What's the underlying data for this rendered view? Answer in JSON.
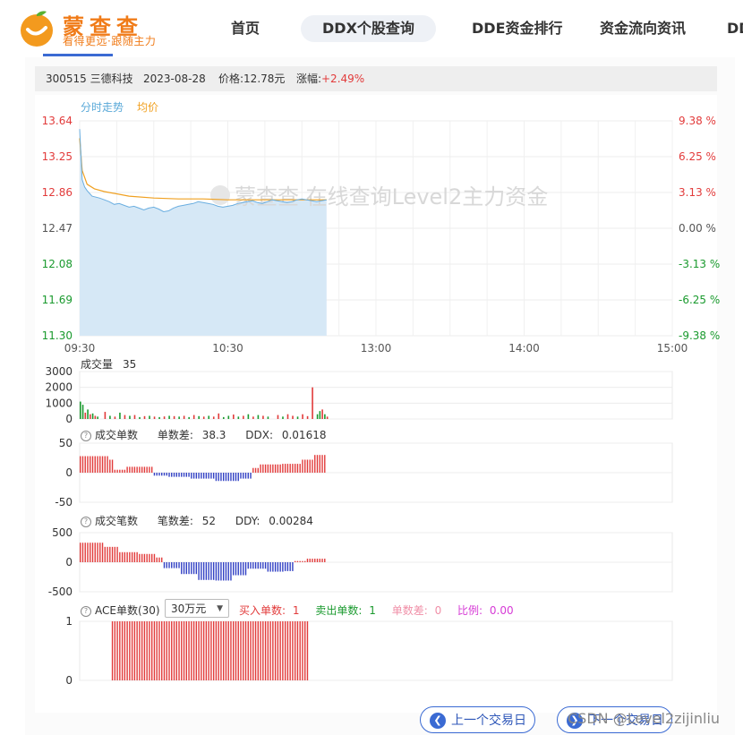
{
  "header": {
    "logo_title": "蒙查查",
    "logo_slogan": "看得更远·跟随主力",
    "nav": [
      "首页",
      "DDX个股查询",
      "DDE资金排行",
      "资金流向资讯",
      "DD"
    ],
    "active_nav": "DDX个股查询"
  },
  "info": {
    "code_name": "300515 三德科技",
    "date": "2023-08-28",
    "price_label": "价格:12.78元",
    "change_label": "涨幅:",
    "change_value": "+2.49%"
  },
  "colors": {
    "up": "#e23b3b",
    "down": "#1a9a2e",
    "ddx_neg": "#3140c4",
    "price_line": "#6aaee0",
    "avg_line": "#f0a020",
    "fill": "#d6e8f6"
  },
  "chart_data": [
    {
      "type": "line",
      "legend": [
        "分时走势",
        "均价"
      ],
      "watermark": "蒙查查 在线查询Level2主力资金",
      "yticks_left": [
        "13.64",
        "13.25",
        "12.86",
        "12.47",
        "12.08",
        "11.69",
        "11.30"
      ],
      "yticks_right": [
        "9.38 %",
        "6.25 %",
        "3.13 %",
        "0.00 %",
        "-3.13 %",
        "-6.25 %",
        "-9.38 %"
      ],
      "ylim": [
        11.3,
        13.64
      ],
      "xticks": [
        "09:30",
        "10:30",
        "13:00",
        "14:00",
        "15:00"
      ],
      "x_domain_minutes": [
        0,
        240
      ],
      "price_series": [
        [
          0,
          13.55
        ],
        [
          1,
          13.0
        ],
        [
          2,
          12.92
        ],
        [
          3,
          12.88
        ],
        [
          5,
          12.82
        ],
        [
          8,
          12.8
        ],
        [
          10,
          12.78
        ],
        [
          12,
          12.76
        ],
        [
          14,
          12.73
        ],
        [
          16,
          12.74
        ],
        [
          18,
          12.72
        ],
        [
          20,
          12.7
        ],
        [
          22,
          12.71
        ],
        [
          24,
          12.69
        ],
        [
          26,
          12.67
        ],
        [
          28,
          12.69
        ],
        [
          30,
          12.7
        ],
        [
          32,
          12.68
        ],
        [
          34,
          12.65
        ],
        [
          36,
          12.66
        ],
        [
          38,
          12.69
        ],
        [
          40,
          12.71
        ],
        [
          42,
          12.72
        ],
        [
          44,
          12.73
        ],
        [
          46,
          12.74
        ],
        [
          48,
          12.76
        ],
        [
          50,
          12.75
        ],
        [
          52,
          12.74
        ],
        [
          54,
          12.73
        ],
        [
          56,
          12.71
        ],
        [
          58,
          12.7
        ],
        [
          60,
          12.71
        ],
        [
          62,
          12.72
        ],
        [
          64,
          12.74
        ],
        [
          66,
          12.75
        ],
        [
          68,
          12.76
        ],
        [
          70,
          12.77
        ],
        [
          72,
          12.75
        ],
        [
          74,
          12.74
        ],
        [
          76,
          12.76
        ],
        [
          78,
          12.78
        ],
        [
          80,
          12.77
        ],
        [
          82,
          12.76
        ],
        [
          84,
          12.75
        ],
        [
          86,
          12.76
        ],
        [
          88,
          12.78
        ],
        [
          90,
          12.79
        ],
        [
          92,
          12.78
        ],
        [
          94,
          12.77
        ],
        [
          96,
          12.76
        ],
        [
          98,
          12.77
        ],
        [
          100,
          12.78
        ]
      ],
      "avg_series": [
        [
          0,
          13.45
        ],
        [
          1,
          13.1
        ],
        [
          3,
          12.95
        ],
        [
          6,
          12.9
        ],
        [
          10,
          12.87
        ],
        [
          20,
          12.82
        ],
        [
          30,
          12.8
        ],
        [
          40,
          12.79
        ],
        [
          50,
          12.79
        ],
        [
          60,
          12.78
        ],
        [
          70,
          12.78
        ],
        [
          80,
          12.78
        ],
        [
          90,
          12.78
        ],
        [
          100,
          12.78
        ]
      ]
    },
    {
      "type": "bar",
      "label": "成交量",
      "value_label": "35",
      "yticks": [
        "3000",
        "2000",
        "1000",
        "0"
      ],
      "ylim": [
        0,
        3000
      ],
      "bars": [
        [
          0,
          1100,
          "down"
        ],
        [
          1,
          900,
          "down"
        ],
        [
          2,
          400,
          "up"
        ],
        [
          3,
          600,
          "down"
        ],
        [
          4,
          300,
          "up"
        ],
        [
          5,
          350,
          "down"
        ],
        [
          6,
          200,
          "up"
        ],
        [
          7,
          150,
          "down"
        ],
        [
          10,
          450,
          "up"
        ],
        [
          12,
          200,
          "down"
        ],
        [
          14,
          150,
          "up"
        ],
        [
          16,
          400,
          "down"
        ],
        [
          18,
          250,
          "up"
        ],
        [
          20,
          200,
          "down"
        ],
        [
          22,
          250,
          "up"
        ],
        [
          24,
          120,
          "down"
        ],
        [
          26,
          180,
          "up"
        ],
        [
          28,
          200,
          "down"
        ],
        [
          30,
          150,
          "up"
        ],
        [
          32,
          120,
          "down"
        ],
        [
          34,
          160,
          "up"
        ],
        [
          36,
          200,
          "down"
        ],
        [
          38,
          180,
          "up"
        ],
        [
          40,
          150,
          "down"
        ],
        [
          42,
          200,
          "up"
        ],
        [
          44,
          120,
          "down"
        ],
        [
          46,
          250,
          "up"
        ],
        [
          48,
          180,
          "down"
        ],
        [
          50,
          150,
          "up"
        ],
        [
          52,
          200,
          "down"
        ],
        [
          54,
          150,
          "up"
        ],
        [
          56,
          350,
          "up"
        ],
        [
          58,
          120,
          "down"
        ],
        [
          60,
          200,
          "down"
        ],
        [
          62,
          280,
          "up"
        ],
        [
          64,
          150,
          "down"
        ],
        [
          66,
          200,
          "up"
        ],
        [
          68,
          300,
          "down"
        ],
        [
          70,
          150,
          "up"
        ],
        [
          72,
          250,
          "down"
        ],
        [
          74,
          200,
          "up"
        ],
        [
          76,
          150,
          "down"
        ],
        [
          80,
          250,
          "up"
        ],
        [
          82,
          150,
          "down"
        ],
        [
          84,
          300,
          "up"
        ],
        [
          86,
          200,
          "up"
        ],
        [
          88,
          150,
          "down"
        ],
        [
          90,
          300,
          "up"
        ],
        [
          92,
          180,
          "up"
        ],
        [
          94,
          2000,
          "up"
        ],
        [
          96,
          300,
          "down"
        ],
        [
          97,
          500,
          "down"
        ],
        [
          98,
          600,
          "up"
        ],
        [
          99,
          300,
          "down"
        ],
        [
          100,
          150,
          "up"
        ]
      ]
    },
    {
      "type": "bar",
      "title": "成交单数",
      "stat1_label": "单数差:",
      "stat1_value": "38.3",
      "stat2_label": "DDX:",
      "stat2_value": "0.01618",
      "yticks": [
        "50",
        "0",
        "-50"
      ],
      "ylim": [
        -50,
        50
      ],
      "segments": [
        [
          0,
          12,
          28
        ],
        [
          12,
          14,
          22
        ],
        [
          14,
          19,
          5
        ],
        [
          19,
          30,
          10
        ],
        [
          30,
          36,
          -5
        ],
        [
          36,
          45,
          -7
        ],
        [
          45,
          55,
          -10
        ],
        [
          55,
          65,
          -14
        ],
        [
          65,
          70,
          -10
        ],
        [
          70,
          73,
          8
        ],
        [
          73,
          82,
          14
        ],
        [
          82,
          90,
          15
        ],
        [
          90,
          95,
          22
        ],
        [
          95,
          100,
          30
        ]
      ]
    },
    {
      "type": "bar",
      "title": "成交笔数",
      "stat1_label": "笔数差:",
      "stat1_value": "52",
      "stat2_label": "DDY:",
      "stat2_value": "0.00284",
      "yticks": [
        "500",
        "0",
        "-500"
      ],
      "ylim": [
        -500,
        500
      ],
      "segments": [
        [
          0,
          10,
          330
        ],
        [
          10,
          16,
          260
        ],
        [
          16,
          24,
          170
        ],
        [
          24,
          31,
          140
        ],
        [
          31,
          34,
          80
        ],
        [
          34,
          41,
          -100
        ],
        [
          41,
          48,
          -200
        ],
        [
          48,
          55,
          -300
        ],
        [
          55,
          62,
          -310
        ],
        [
          62,
          68,
          -220
        ],
        [
          68,
          76,
          -110
        ],
        [
          76,
          83,
          -160
        ],
        [
          83,
          87,
          -150
        ],
        [
          87,
          92,
          20
        ],
        [
          92,
          100,
          60
        ]
      ]
    },
    {
      "type": "bar",
      "title": "ACE单数(30)",
      "select_value": "30万元",
      "buy_label": "买入单数:",
      "buy_value": "1",
      "sell_label": "卖出单数:",
      "sell_value": "1",
      "diff_label": "单数差:",
      "diff_value": "0",
      "ratio_label": "比例:",
      "ratio_value": "0.00",
      "yticks": [
        "1",
        "0"
      ],
      "ylim": [
        0,
        1
      ],
      "bar_range": [
        13,
        93
      ],
      "bar_value": 1
    }
  ],
  "buttons": {
    "prev": "上一个交易日",
    "next": "下一个交易日"
  },
  "watermark": "CSDN @Level2zijinliu"
}
